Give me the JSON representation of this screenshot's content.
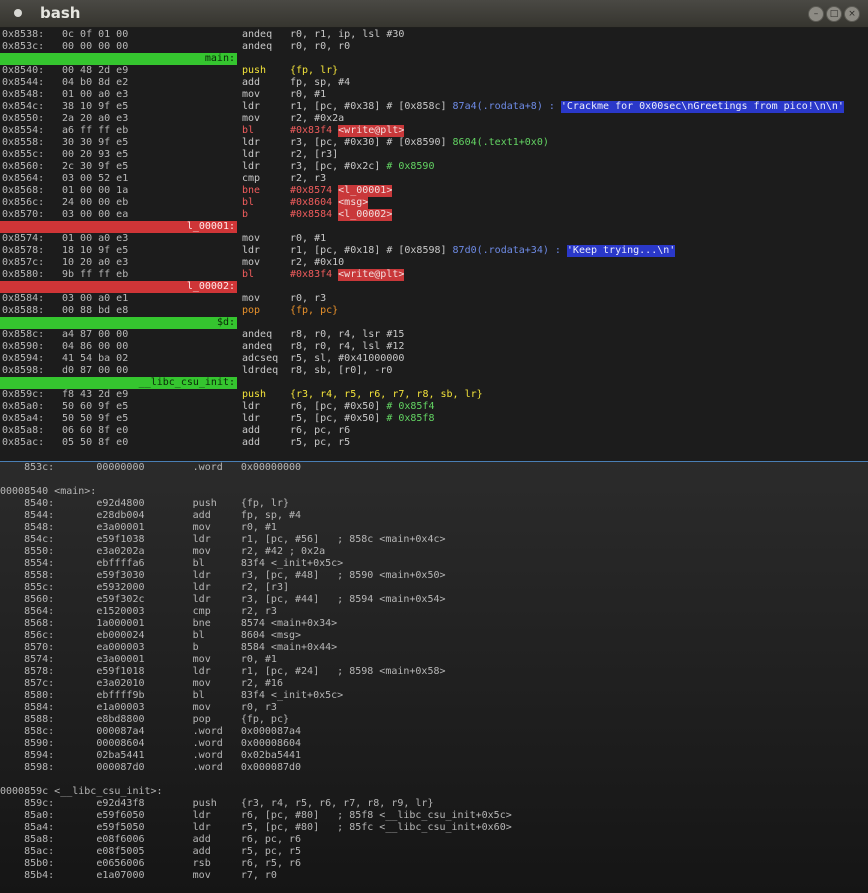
{
  "window": {
    "title": "bash",
    "buttons": [
      "minimize",
      "maximize",
      "close"
    ]
  },
  "top_pane": {
    "lines": [
      {
        "kind": "code",
        "addr": "0x8538:",
        "hex": "0c 0f 01 00",
        "mn": "andeq",
        "ops": "r0, r1, ip, lsl #30"
      },
      {
        "kind": "code",
        "addr": "0x853c:",
        "hex": "00 00 00 00",
        "mn": "andeq",
        "ops": "r0, r0, r0"
      },
      {
        "kind": "label",
        "color": "green",
        "text": "main:"
      },
      {
        "kind": "code",
        "addr": "0x8540:",
        "hex": "00 48 2d e9",
        "mn": "push",
        "mnc": "push",
        "ops": "{fp, lr}",
        "opsc": "y"
      },
      {
        "kind": "code",
        "addr": "0x8544:",
        "hex": "04 b0 8d e2",
        "mn": "add",
        "ops": "fp, sp, #4"
      },
      {
        "kind": "code",
        "addr": "0x8548:",
        "hex": "01 00 a0 e3",
        "mn": "mov",
        "ops": "r0, #1"
      },
      {
        "kind": "code",
        "addr": "0x854c:",
        "hex": "38 10 9f e5",
        "mn": "ldr",
        "ops": "r1, [pc, #0x38] # [0x858c]",
        "cm": "87a4(.rodata+8)",
        "cmc": "blue",
        "sep": " : ",
        "tag": "'Crackme for 0x00sec\\nGreetings from pico!\\n\\n'",
        "tagc": "blue"
      },
      {
        "kind": "code",
        "addr": "0x8550:",
        "hex": "2a 20 a0 e3",
        "mn": "mov",
        "ops": "r2, #0x2a"
      },
      {
        "kind": "code",
        "addr": "0x8554:",
        "hex": "a6 ff ff eb",
        "mn": "bl",
        "mnc": "br",
        "ops": "#0x83f4",
        "opsc": "r",
        "tag": "<write@plt>",
        "tagc": "red"
      },
      {
        "kind": "code",
        "addr": "0x8558:",
        "hex": "30 30 9f e5",
        "mn": "ldr",
        "ops": "r3, [pc, #0x30] # [0x8590]",
        "cm": "8604(.text1+0x0)",
        "cmc": "green"
      },
      {
        "kind": "code",
        "addr": "0x855c:",
        "hex": "00 20 93 e5",
        "mn": "ldr",
        "ops": "r2, [r3]"
      },
      {
        "kind": "code",
        "addr": "0x8560:",
        "hex": "2c 30 9f e5",
        "mn": "ldr",
        "ops": "r3, [pc, #0x2c]",
        "cm": "# 0x8590",
        "cmc": "green"
      },
      {
        "kind": "code",
        "addr": "0x8564:",
        "hex": "03 00 52 e1",
        "mn": "cmp",
        "ops": "r2, r3"
      },
      {
        "kind": "code",
        "addr": "0x8568:",
        "hex": "01 00 00 1a",
        "mn": "bne",
        "mnc": "br",
        "ops": "#0x8574",
        "opsc": "r",
        "tag": "<l_00001>",
        "tagc": "red"
      },
      {
        "kind": "code",
        "addr": "0x856c:",
        "hex": "24 00 00 eb",
        "mn": "bl",
        "mnc": "br",
        "ops": "#0x8604",
        "opsc": "r",
        "tag": "<msg>",
        "tagc": "red"
      },
      {
        "kind": "code",
        "addr": "0x8570:",
        "hex": "03 00 00 ea",
        "mn": "b",
        "mnc": "br",
        "ops": "#0x8584",
        "opsc": "r",
        "tag": "<l_00002>",
        "tagc": "red"
      },
      {
        "kind": "label",
        "color": "red",
        "text": "l_00001:"
      },
      {
        "kind": "code",
        "addr": "0x8574:",
        "hex": "01 00 a0 e3",
        "mn": "mov",
        "ops": "r0, #1"
      },
      {
        "kind": "code",
        "addr": "0x8578:",
        "hex": "18 10 9f e5",
        "mn": "ldr",
        "ops": "r1, [pc, #0x18] # [0x8598]",
        "cm": "87d0(.rodata+34)",
        "cmc": "blue",
        "sep": " : ",
        "tag": "'Keep trying...\\n'",
        "tagc": "blue"
      },
      {
        "kind": "code",
        "addr": "0x857c:",
        "hex": "10 20 a0 e3",
        "mn": "mov",
        "ops": "r2, #0x10"
      },
      {
        "kind": "code",
        "addr": "0x8580:",
        "hex": "9b ff ff eb",
        "mn": "bl",
        "mnc": "br",
        "ops": "#0x83f4",
        "opsc": "r",
        "tag": "<write@plt>",
        "tagc": "red"
      },
      {
        "kind": "label",
        "color": "red",
        "text": "l_00002:"
      },
      {
        "kind": "code",
        "addr": "0x8584:",
        "hex": "03 00 a0 e1",
        "mn": "mov",
        "ops": "r0, r3"
      },
      {
        "kind": "code",
        "addr": "0x8588:",
        "hex": "00 88 bd e8",
        "mn": "pop",
        "mnc": "pop",
        "ops": "{fp, pc}",
        "opsc": "o"
      },
      {
        "kind": "label",
        "color": "green",
        "text": "$d:"
      },
      {
        "kind": "code",
        "addr": "0x858c:",
        "hex": "a4 87 00 00",
        "mn": "andeq",
        "ops": "r8, r0, r4, lsr #15"
      },
      {
        "kind": "code",
        "addr": "0x8590:",
        "hex": "04 86 00 00",
        "mn": "andeq",
        "ops": "r8, r0, r4, lsl #12"
      },
      {
        "kind": "code",
        "addr": "0x8594:",
        "hex": "41 54 ba 02",
        "mn": "adcseq",
        "ops": "r5, sl, #0x41000000"
      },
      {
        "kind": "code",
        "addr": "0x8598:",
        "hex": "d0 87 00 00",
        "mn": "ldrdeq",
        "ops": "r8, sb, [r0], -r0"
      },
      {
        "kind": "label",
        "color": "green",
        "text": "__libc_csu_init:"
      },
      {
        "kind": "code",
        "addr": "0x859c:",
        "hex": "f8 43 2d e9",
        "mn": "push",
        "mnc": "push",
        "ops": "{r3, r4, r5, r6, r7, r8, sb, lr}",
        "opsc": "y"
      },
      {
        "kind": "code",
        "addr": "0x85a0:",
        "hex": "50 60 9f e5",
        "mn": "ldr",
        "ops": "r6, [pc, #0x50]",
        "cm": "# 0x85f4",
        "cmc": "green"
      },
      {
        "kind": "code",
        "addr": "0x85a4:",
        "hex": "50 50 9f e5",
        "mn": "ldr",
        "ops": "r5, [pc, #0x50]",
        "cm": "# 0x85f8",
        "cmc": "green"
      },
      {
        "kind": "code",
        "addr": "0x85a8:",
        "hex": "06 60 8f e0",
        "mn": "add",
        "ops": "r6, pc, r6"
      },
      {
        "kind": "code",
        "addr": "0x85ac:",
        "hex": "05 50 8f e0",
        "mn": "add",
        "ops": "r5, pc, r5"
      }
    ]
  },
  "bottom_pane": {
    "lines": [
      {
        "t": "    853c:       00000000        .word   0x00000000"
      },
      {
        "t": ""
      },
      {
        "t": "00008540 <main>:"
      },
      {
        "t": "    8540:       e92d4800        push    {fp, lr}"
      },
      {
        "t": "    8544:       e28db004        add     fp, sp, #4"
      },
      {
        "t": "    8548:       e3a00001        mov     r0, #1"
      },
      {
        "t": "    854c:       e59f1038        ldr     r1, [pc, #56]   ; 858c <main+0x4c>"
      },
      {
        "t": "    8550:       e3a0202a        mov     r2, #42 ; 0x2a"
      },
      {
        "t": "    8554:       ebffffa6        bl      83f4 <_init+0x5c>"
      },
      {
        "t": "    8558:       e59f3030        ldr     r3, [pc, #48]   ; 8590 <main+0x50>"
      },
      {
        "t": "    855c:       e5932000        ldr     r2, [r3]"
      },
      {
        "t": "    8560:       e59f302c        ldr     r3, [pc, #44]   ; 8594 <main+0x54>"
      },
      {
        "t": "    8564:       e1520003        cmp     r2, r3"
      },
      {
        "t": "    8568:       1a000001        bne     8574 <main+0x34>"
      },
      {
        "t": "    856c:       eb000024        bl      8604 <msg>"
      },
      {
        "t": "    8570:       ea000003        b       8584 <main+0x44>"
      },
      {
        "t": "    8574:       e3a00001        mov     r0, #1"
      },
      {
        "t": "    8578:       e59f1018        ldr     r1, [pc, #24]   ; 8598 <main+0x58>"
      },
      {
        "t": "    857c:       e3a02010        mov     r2, #16"
      },
      {
        "t": "    8580:       ebffff9b        bl      83f4 <_init+0x5c>"
      },
      {
        "t": "    8584:       e1a00003        mov     r0, r3"
      },
      {
        "t": "    8588:       e8bd8800        pop     {fp, pc}"
      },
      {
        "t": "    858c:       000087a4        .word   0x000087a4"
      },
      {
        "t": "    8590:       00008604        .word   0x00008604"
      },
      {
        "t": "    8594:       02ba5441        .word   0x02ba5441"
      },
      {
        "t": "    8598:       000087d0        .word   0x000087d0"
      },
      {
        "t": ""
      },
      {
        "t": "0000859c <__libc_csu_init>:"
      },
      {
        "t": "    859c:       e92d43f8        push    {r3, r4, r5, r6, r7, r8, r9, lr}"
      },
      {
        "t": "    85a0:       e59f6050        ldr     r6, [pc, #80]   ; 85f8 <__libc_csu_init+0x5c>"
      },
      {
        "t": "    85a4:       e59f5050        ldr     r5, [pc, #80]   ; 85fc <__libc_csu_init+0x60>"
      },
      {
        "t": "    85a8:       e08f6006        add     r6, pc, r6"
      },
      {
        "t": "    85ac:       e08f5005        add     r5, pc, r5"
      },
      {
        "t": "    85b0:       e0656006        rsb     r6, r5, r6"
      },
      {
        "t": "    85b4:       e1a07000        mov     r7, r0"
      }
    ]
  }
}
